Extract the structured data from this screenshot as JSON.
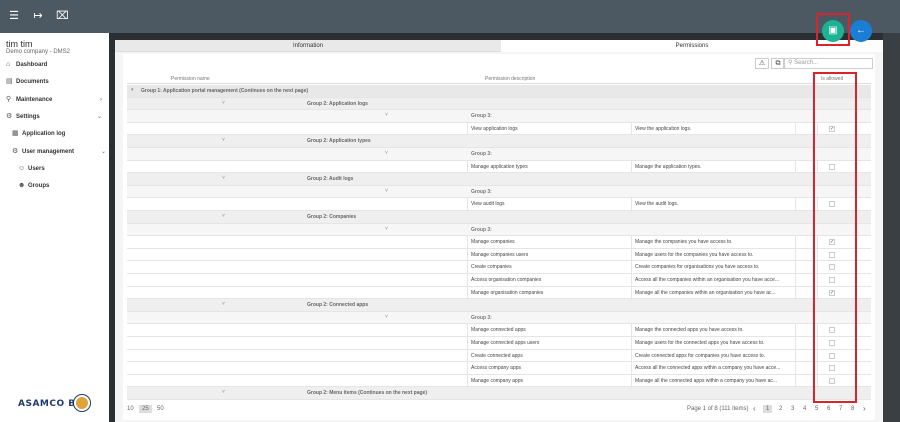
{
  "topbar": {
    "icons": [
      "menu-icon",
      "exit-icon",
      "close-box-icon"
    ]
  },
  "user": {
    "name": "tim tim",
    "company": "Demo company - DMS2"
  },
  "nav": [
    {
      "label": "Dashboard",
      "icon": "home-icon"
    },
    {
      "label": "Documents",
      "icon": "document-icon"
    },
    {
      "label": "Maintenance",
      "icon": "wrench-icon"
    },
    {
      "label": "Settings",
      "icon": "gear-icon"
    },
    {
      "label": "Application log",
      "icon": "log-icon"
    },
    {
      "label": "User management",
      "icon": "users-gear-icon"
    },
    {
      "label": "Users",
      "icon": "user-icon"
    },
    {
      "label": "Groups",
      "icon": "group-icon"
    }
  ],
  "logo": {
    "text": "ASAMCO B.V."
  },
  "tabs": [
    "Information",
    "Permissions"
  ],
  "search": {
    "placeholder": "Search..."
  },
  "columns": {
    "name": "Permission name",
    "description": "Permission description",
    "allowed": "Is allowed"
  },
  "rows": [
    {
      "type": "group1",
      "label": "Group 1: Application portal management (Continues on the next page)"
    },
    {
      "type": "group2",
      "label": "Group 2: Application logs"
    },
    {
      "type": "group3",
      "label": "Group 3:"
    },
    {
      "type": "item",
      "name": "View application logs",
      "desc": "View the application logs.",
      "checked": true
    },
    {
      "type": "group2",
      "label": "Group 2: Application types"
    },
    {
      "type": "group3",
      "label": "Group 3:"
    },
    {
      "type": "item",
      "name": "Manage application types",
      "desc": "Manage the application types.",
      "checked": false
    },
    {
      "type": "group2",
      "label": "Group 2: Audit logs"
    },
    {
      "type": "group3",
      "label": "Group 3:"
    },
    {
      "type": "item",
      "name": "View audit logs",
      "desc": "View the audit logs.",
      "checked": false
    },
    {
      "type": "group2",
      "label": "Group 2: Companies"
    },
    {
      "type": "group3",
      "label": "Group 3:"
    },
    {
      "type": "item",
      "name": "Manage companies",
      "desc": "Manage the companies you have access to.",
      "checked": true
    },
    {
      "type": "item",
      "name": "Manage companies users",
      "desc": "Manage users for the companies you have access to.",
      "checked": false
    },
    {
      "type": "item",
      "name": "Create companies",
      "desc": "Create companies for organisations you have access to.",
      "checked": false
    },
    {
      "type": "item",
      "name": "Access organisation companies",
      "desc": "Access all the companies within an organisation you have acce...",
      "checked": false
    },
    {
      "type": "item",
      "name": "Manage organisation companies",
      "desc": "Manage all the companies within an organisation you have ac...",
      "checked": true
    },
    {
      "type": "group2",
      "label": "Group 2: Connected apps"
    },
    {
      "type": "group3",
      "label": "Group 3:"
    },
    {
      "type": "item",
      "name": "Manage connected apps",
      "desc": "Manage the connected apps you have access to.",
      "checked": false
    },
    {
      "type": "item",
      "name": "Manage connected apps users",
      "desc": "Manage users for the connected apps you have access to.",
      "checked": false
    },
    {
      "type": "item",
      "name": "Create connected apps",
      "desc": "Create connected apps for companies you have access to.",
      "checked": false
    },
    {
      "type": "item",
      "name": "Access company apps",
      "desc": "Access all the connected apps within a company you have acce...",
      "checked": false
    },
    {
      "type": "item",
      "name": "Manage company apps",
      "desc": "Manage all the connected apps within a company you have ac...",
      "checked": false
    },
    {
      "type": "group2",
      "label": "Group 2: Menu items (Continues on the next page)"
    }
  ],
  "pager": {
    "sizes": [
      "10",
      "25",
      "50"
    ],
    "selected_size": "25",
    "info": "Page 1 of 8 (111 items)",
    "pages": [
      "1",
      "2",
      "3",
      "4",
      "5",
      "6",
      "7",
      "8"
    ],
    "current": "1"
  },
  "colors": {
    "save": "#1bb394",
    "back": "#1a7fd4",
    "highlight": "#d6262b"
  }
}
